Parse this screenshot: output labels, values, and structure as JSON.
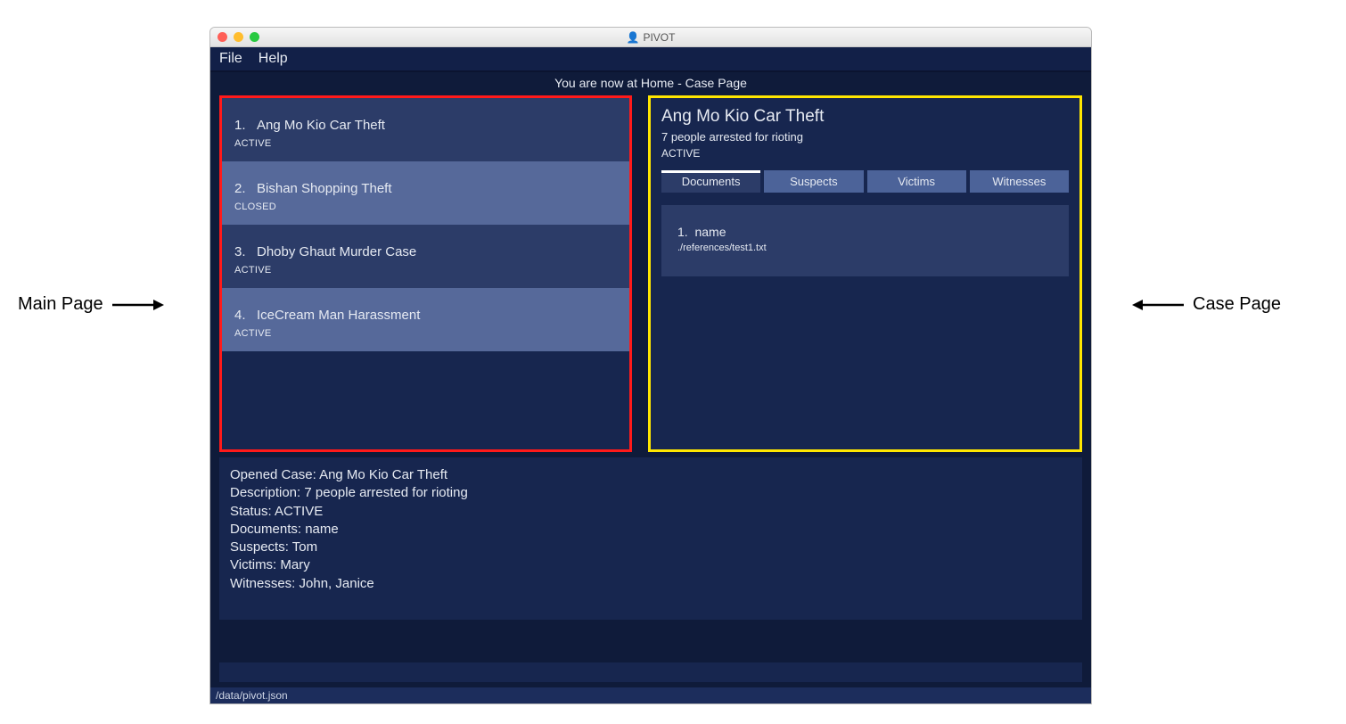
{
  "window": {
    "title": "PIVOT"
  },
  "menu": {
    "file": "File",
    "help": "Help"
  },
  "breadcrumb": "You are now at Home - Case Page",
  "cases": [
    {
      "idx": "1.",
      "name": "Ang Mo Kio Car Theft",
      "status": "ACTIVE",
      "shade": "dark"
    },
    {
      "idx": "2.",
      "name": "Bishan Shopping Theft",
      "status": "CLOSED",
      "shade": "light"
    },
    {
      "idx": "3.",
      "name": "Dhoby Ghaut Murder Case",
      "status": "ACTIVE",
      "shade": "dark"
    },
    {
      "idx": "4.",
      "name": "IceCream Man Harassment",
      "status": "ACTIVE",
      "shade": "light"
    }
  ],
  "case_page": {
    "title": "Ang Mo Kio Car Theft",
    "desc": "7 people arrested for rioting",
    "status": "ACTIVE",
    "tabs": [
      "Documents",
      "Suspects",
      "Victims",
      "Witnesses"
    ],
    "active_tab": 0,
    "doc": {
      "idx": "1.",
      "name": "name",
      "path": "./references/test1.txt"
    }
  },
  "details": {
    "opened": "Opened Case: Ang Mo Kio Car Theft",
    "description": "Description: 7 people arrested for rioting",
    "status": "Status: ACTIVE",
    "documents": "Documents: name",
    "suspects": "Suspects: Tom",
    "victims": "Victims: Mary",
    "witnesses": "Witnesses: John, Janice"
  },
  "status_path": "/data/pivot.json",
  "annotations": {
    "left": "Main Page",
    "right": "Case Page"
  }
}
